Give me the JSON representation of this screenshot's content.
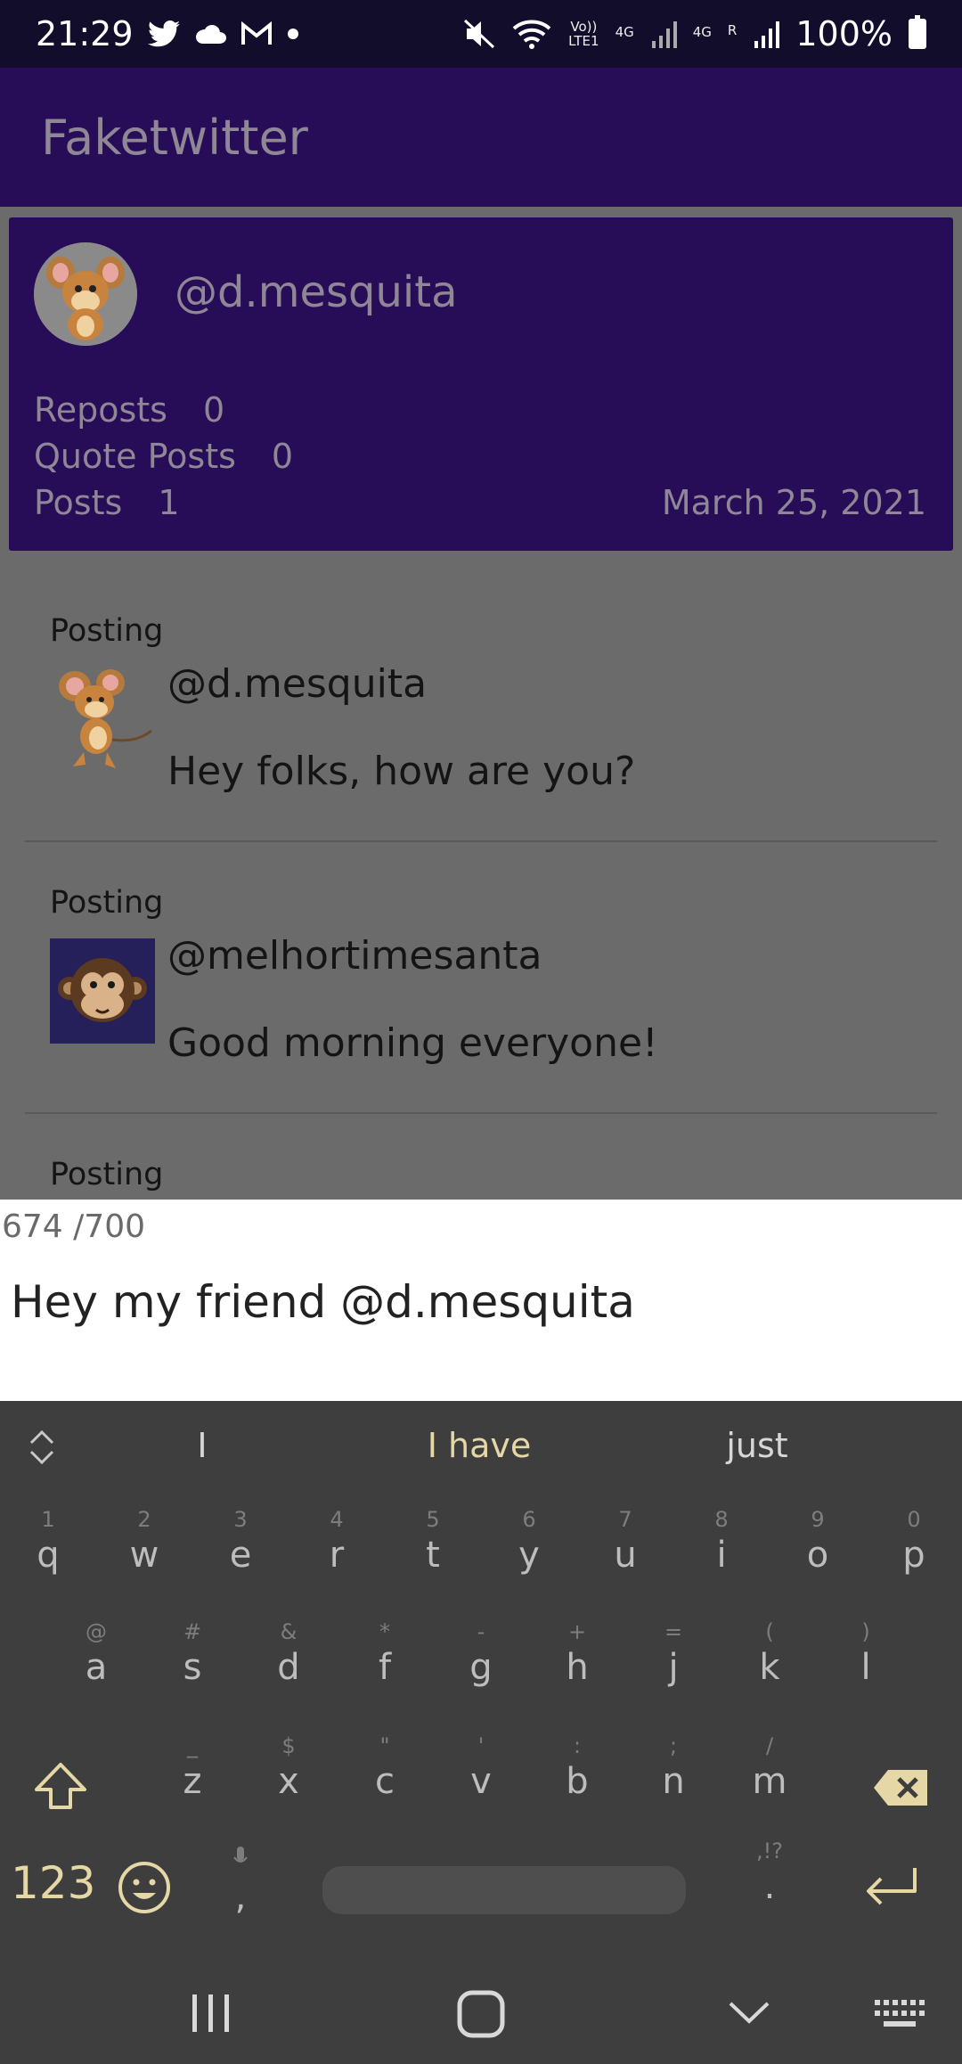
{
  "status_bar": {
    "time": "21:29",
    "battery_percent": "100%",
    "volte_label": "Vo))",
    "lte_label": "LTE1",
    "net1": "4G",
    "net2": "4G",
    "roaming": "R",
    "left_icons": [
      "twitter-icon",
      "cloud-icon",
      "gmail-icon",
      "dot-icon"
    ],
    "right_icons": [
      "mute-icon",
      "wifi-icon",
      "signal-icon",
      "signal-icon",
      "battery-icon"
    ]
  },
  "app_bar": {
    "title": "Faketwitter"
  },
  "profile": {
    "handle": "@d.mesquita",
    "stats": [
      {
        "label": "Reposts",
        "value": "0"
      },
      {
        "label": "Quote Posts",
        "value": "0"
      },
      {
        "label": "Posts",
        "value": "1"
      }
    ],
    "date": "March 25, 2021"
  },
  "posts": [
    {
      "label": "Posting",
      "handle": "@d.mesquita",
      "body": "Hey folks, how are you?",
      "avatar": "mouse-avatar"
    },
    {
      "label": "Posting",
      "handle": "@melhortimesanta",
      "body": "Good morning everyone!",
      "avatar": "monkey-avatar"
    },
    {
      "label": "Posting",
      "handle": "",
      "body": "",
      "avatar": ""
    }
  ],
  "composer": {
    "counter": "674 /700",
    "text": "Hey my friend @d.mesquita"
  },
  "keyboard": {
    "suggestions": [
      "I",
      "I have",
      "just"
    ],
    "row1": [
      {
        "hint": "1",
        "key": "q"
      },
      {
        "hint": "2",
        "key": "w"
      },
      {
        "hint": "3",
        "key": "e"
      },
      {
        "hint": "4",
        "key": "r"
      },
      {
        "hint": "5",
        "key": "t"
      },
      {
        "hint": "6",
        "key": "y"
      },
      {
        "hint": "7",
        "key": "u"
      },
      {
        "hint": "8",
        "key": "i"
      },
      {
        "hint": "9",
        "key": "o"
      },
      {
        "hint": "0",
        "key": "p"
      }
    ],
    "row2": [
      {
        "hint": "@",
        "key": "a"
      },
      {
        "hint": "#",
        "key": "s"
      },
      {
        "hint": "&",
        "key": "d"
      },
      {
        "hint": "*",
        "key": "f"
      },
      {
        "hint": "-",
        "key": "g"
      },
      {
        "hint": "+",
        "key": "h"
      },
      {
        "hint": "=",
        "key": "j"
      },
      {
        "hint": "(",
        "key": "k"
      },
      {
        "hint": ")",
        "key": "l"
      }
    ],
    "row3": [
      {
        "hint": "_",
        "key": "z"
      },
      {
        "hint": "$",
        "key": "x"
      },
      {
        "hint": "\"",
        "key": "c"
      },
      {
        "hint": "'",
        "key": "v"
      },
      {
        "hint": ":",
        "key": "b"
      },
      {
        "hint": ";",
        "key": "n"
      },
      {
        "hint": "/",
        "key": "m"
      }
    ],
    "num_label": "123",
    "comma_label": ",",
    "period_label": ".",
    "period_hint": ",!?"
  },
  "colors": {
    "accent_purple": "#270c57",
    "status_bar": "#130d2c",
    "keyboard_bg": "#3e3e3e",
    "highlight_yellow": "#e5d8a6"
  }
}
